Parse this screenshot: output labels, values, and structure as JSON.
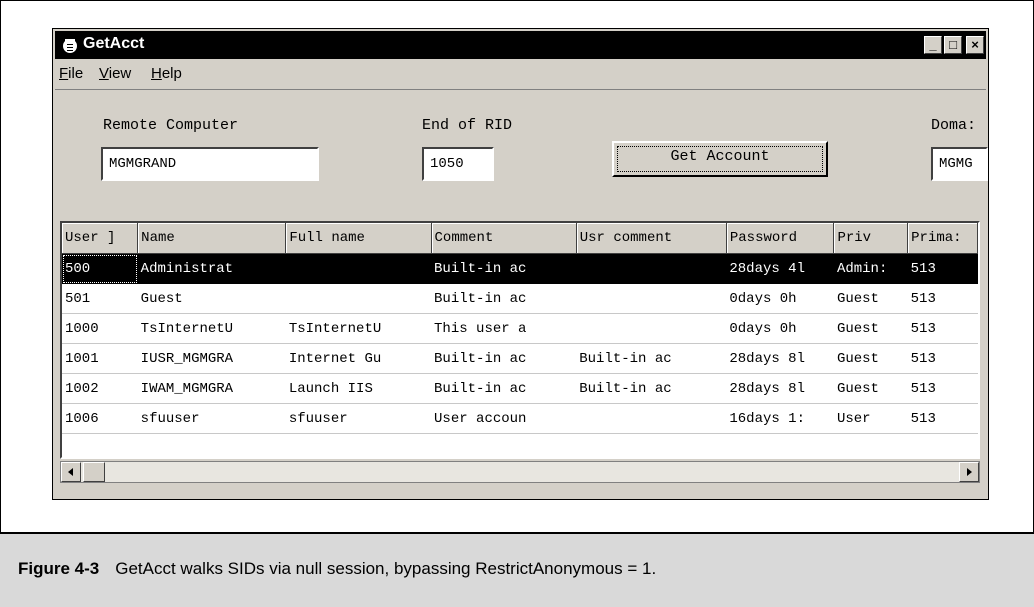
{
  "window": {
    "title": "GetAcct",
    "controls": [
      "_",
      "□",
      "×"
    ]
  },
  "menu": [
    {
      "prefix": "",
      "key": "F",
      "rest": "ile"
    },
    {
      "prefix": "",
      "key": "V",
      "rest": "iew"
    },
    {
      "prefix": "",
      "key": "H",
      "rest": "elp"
    }
  ],
  "form": {
    "remote_computer_label": "Remote Computer",
    "remote_computer_value": "MGMGRAND",
    "end_rid_label": "End of RID",
    "end_rid_value": "1050",
    "get_account_button": "Get Account",
    "domain_label": "Doma:",
    "domain_value": "MGMG"
  },
  "table": {
    "columns": [
      "User ]",
      "Name",
      "Full name",
      "Comment",
      "Usr comment",
      "Password",
      "Priv",
      "Prima:"
    ],
    "rows": [
      [
        "500",
        "Administrat",
        "",
        "Built-in ac",
        "",
        "28days 4l",
        "Admin:",
        "513"
      ],
      [
        "501",
        "Guest",
        "",
        "Built-in ac",
        "",
        "0days 0h",
        "Guest",
        "513"
      ],
      [
        "1000",
        "TsInternetU",
        "TsInternetU",
        "This user a",
        "",
        "0days 0h",
        "Guest",
        "513"
      ],
      [
        "1001",
        "IUSR_MGMGRA",
        "Internet Gu",
        "Built-in ac",
        "Built-in ac",
        "28days 8l",
        "Guest",
        "513"
      ],
      [
        "1002",
        "IWAM_MGMGRA",
        "Launch IIS",
        "Built-in ac",
        "Built-in ac",
        "28days 8l",
        "Guest",
        "513"
      ],
      [
        "1006",
        "sfuuser",
        "sfuuser",
        "User accoun",
        "",
        "16days 1:",
        "User",
        "513"
      ]
    ],
    "selected_row": 0
  },
  "caption": {
    "label": "Figure 4-3",
    "text": "GetAcct walks SIDs via null session, bypassing RestrictAnonymous = 1."
  },
  "icons": {
    "app": "app-icon",
    "scroll_left": "scroll-left-arrow-icon",
    "scroll_right": "scroll-right-arrow-icon"
  },
  "colors": {
    "titlebar": "#000000",
    "window_face": "#d4d0c8",
    "selection": "#000000",
    "caption_bg": "#d9d9d9"
  }
}
